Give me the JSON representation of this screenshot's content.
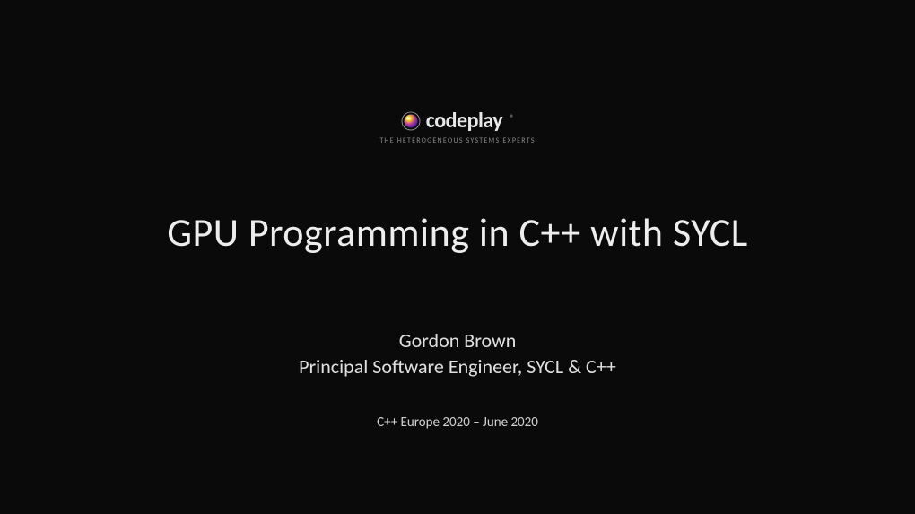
{
  "logo": {
    "name": "codeplay",
    "tagline": "THE HETEROGENEOUS SYSTEMS EXPERTS",
    "registered": "®"
  },
  "title": "GPU Programming in C++ with SYCL",
  "author": {
    "name": "Gordon Brown",
    "role": "Principal Software Engineer, SYCL & C++"
  },
  "event": "C++ Europe 2020 – June 2020"
}
